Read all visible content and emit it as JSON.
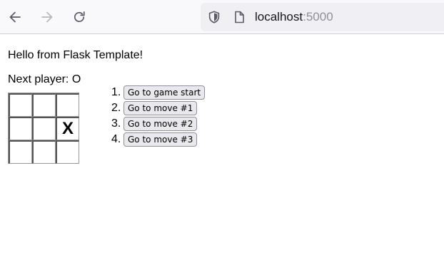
{
  "browser": {
    "back_icon": "arrow-left-icon",
    "forward_icon": "arrow-right-icon",
    "reload_icon": "reload-icon",
    "shield_icon": "shield-icon",
    "page_icon": "page-icon",
    "url_host": "localhost",
    "url_port": ":5000"
  },
  "page": {
    "greeting": "Hello from Flask Template!",
    "status": "Next player: O"
  },
  "board": {
    "squares": [
      "",
      "",
      "",
      "",
      "",
      "X",
      "",
      "",
      ""
    ]
  },
  "moves": [
    {
      "number": "1.",
      "label": "Go to game start"
    },
    {
      "number": "2.",
      "label": "Go to move #1"
    },
    {
      "number": "3.",
      "label": "Go to move #2"
    },
    {
      "number": "4.",
      "label": "Go to move #3"
    }
  ]
}
